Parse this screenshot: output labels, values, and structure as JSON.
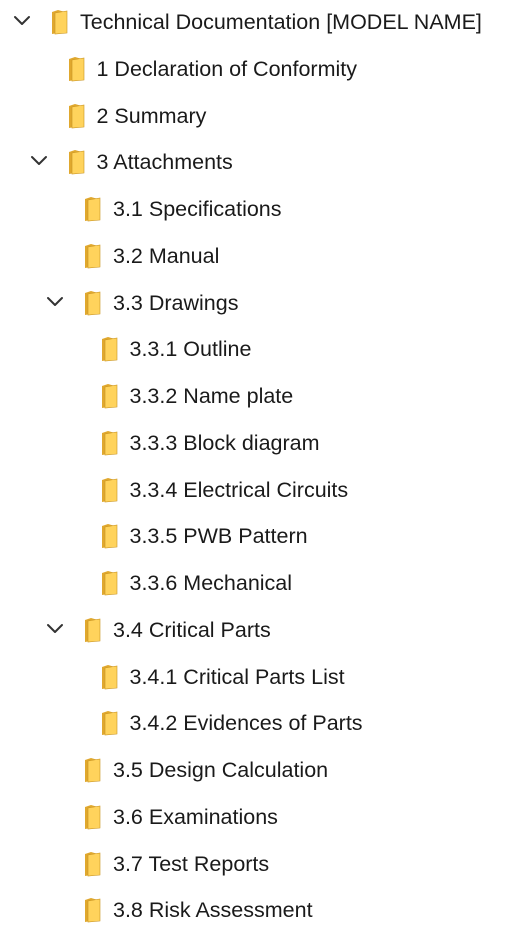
{
  "colors": {
    "folder_back": "#e0a82e",
    "folder_front": "#ffd35c",
    "folder_edge": "#c99422",
    "chevron": "#333333",
    "text": "#1a1a1a"
  },
  "tree": [
    {
      "label": "Technical Documentation [MODEL NAME]",
      "depth": 0,
      "expanded": true,
      "icon": "folder-icon"
    },
    {
      "label": "1 Declaration of Conformity",
      "depth": 1,
      "expanded": null,
      "icon": "folder-icon"
    },
    {
      "label": "2 Summary",
      "depth": 1,
      "expanded": null,
      "icon": "folder-icon"
    },
    {
      "label": "3 Attachments",
      "depth": 1,
      "expanded": true,
      "icon": "folder-icon"
    },
    {
      "label": "3.1 Specifications",
      "depth": 2,
      "expanded": null,
      "icon": "folder-icon"
    },
    {
      "label": "3.2 Manual",
      "depth": 2,
      "expanded": null,
      "icon": "folder-icon"
    },
    {
      "label": "3.3 Drawings",
      "depth": 2,
      "expanded": true,
      "icon": "folder-icon"
    },
    {
      "label": "3.3.1 Outline",
      "depth": 3,
      "expanded": null,
      "icon": "folder-icon"
    },
    {
      "label": "3.3.2 Name plate",
      "depth": 3,
      "expanded": null,
      "icon": "folder-icon"
    },
    {
      "label": "3.3.3 Block diagram",
      "depth": 3,
      "expanded": null,
      "icon": "folder-icon"
    },
    {
      "label": "3.3.4 Electrical Circuits",
      "depth": 3,
      "expanded": null,
      "icon": "folder-icon"
    },
    {
      "label": "3.3.5 PWB Pattern",
      "depth": 3,
      "expanded": null,
      "icon": "folder-icon"
    },
    {
      "label": "3.3.6 Mechanical",
      "depth": 3,
      "expanded": null,
      "icon": "folder-icon"
    },
    {
      "label": "3.4 Critical Parts",
      "depth": 2,
      "expanded": true,
      "icon": "folder-icon"
    },
    {
      "label": "3.4.1 Critical Parts List",
      "depth": 3,
      "expanded": null,
      "icon": "folder-icon"
    },
    {
      "label": "3.4.2 Evidences of Parts",
      "depth": 3,
      "expanded": null,
      "icon": "folder-icon"
    },
    {
      "label": "3.5 Design Calculation",
      "depth": 2,
      "expanded": null,
      "icon": "folder-icon"
    },
    {
      "label": "3.6 Examinations",
      "depth": 2,
      "expanded": null,
      "icon": "folder-icon"
    },
    {
      "label": "3.7 Test Reports",
      "depth": 2,
      "expanded": null,
      "icon": "folder-icon"
    },
    {
      "label": "3.8 Risk Assessment",
      "depth": 2,
      "expanded": null,
      "icon": "folder-icon"
    }
  ]
}
